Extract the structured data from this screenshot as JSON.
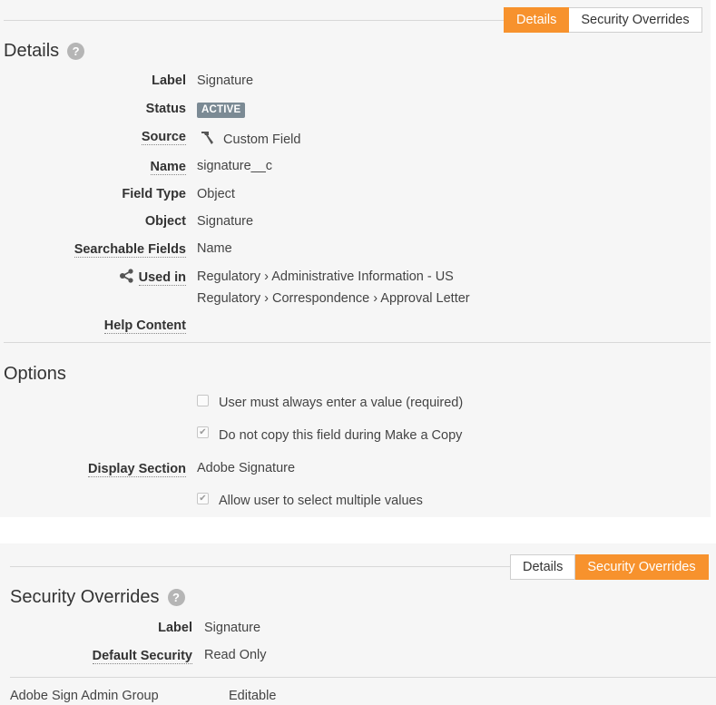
{
  "details_panel": {
    "tabs": [
      {
        "label": "Details",
        "active": true
      },
      {
        "label": "Security Overrides",
        "active": false
      }
    ],
    "title": "Details",
    "fields": {
      "label": {
        "name": "Label",
        "value": "Signature"
      },
      "status": {
        "name": "Status",
        "value": "ACTIVE"
      },
      "source": {
        "name": "Source",
        "value": "Custom Field",
        "icon": "hammer-icon"
      },
      "name": {
        "name": "Name",
        "value": "signature__c"
      },
      "field_type": {
        "name": "Field Type",
        "value": "Object"
      },
      "object": {
        "name": "Object",
        "value": "Signature"
      },
      "searchable_fields": {
        "name": "Searchable Fields",
        "value": "Name"
      },
      "used_in": {
        "name": "Used in",
        "icon": "share-network-icon",
        "values": [
          "Regulatory › Administrative Information - US",
          "Regulatory › Correspondence › Approval Letter"
        ]
      },
      "help_content": {
        "name": "Help Content",
        "value": ""
      }
    },
    "options": {
      "title": "Options",
      "required": {
        "label": "User must always enter a value (required)",
        "checked": false
      },
      "no_copy": {
        "label": "Do not copy this field during Make a Copy",
        "checked": true
      },
      "display_section": {
        "name": "Display Section",
        "value": "Adobe Signature"
      },
      "multiple_values": {
        "label": "Allow user to select multiple values",
        "checked": true
      }
    }
  },
  "security_panel": {
    "tabs": [
      {
        "label": "Details",
        "active": false
      },
      {
        "label": "Security Overrides",
        "active": true
      }
    ],
    "title": "Security Overrides",
    "label": {
      "name": "Label",
      "value": "Signature"
    },
    "default_security": {
      "name": "Default Security",
      "value": "Read Only"
    },
    "overrides": [
      {
        "group": "Adobe Sign Admin Group",
        "access": "Editable"
      }
    ]
  },
  "colors": {
    "accent": "#f7922d",
    "panel_bg": "#f6f6f6",
    "badge_bg": "#7b8a94"
  }
}
